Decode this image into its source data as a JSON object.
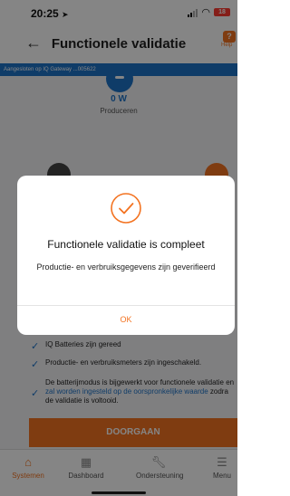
{
  "status_bar": {
    "time": "20:25",
    "location_glyph": "➤",
    "battery_level": "18"
  },
  "header": {
    "title": "Functionele validatie",
    "back_icon": "back-arrow-icon",
    "help_label": "Help"
  },
  "connection": {
    "text": "Aangesloten op IQ Gateway ...005622"
  },
  "produce": {
    "value": "0 W",
    "label": "Produceren"
  },
  "checklist": [
    {
      "text": "IQ Batteries zijn gereed"
    },
    {
      "text": "Productie- en verbruiksmeters zijn ingeschakeld."
    },
    {
      "text_before": "De batterijmodus is bijgewerkt voor functionele validatie en ",
      "link": "zal worden ingesteld op de oorspronkelijke waarde",
      "text_after": " zodra de validatie is voltooid."
    }
  ],
  "next_button": "DOORGAAN",
  "bottom_nav": [
    {
      "label": "Systemen",
      "icon": "home-icon",
      "active": true
    },
    {
      "label": "Dashboard",
      "icon": "dashboard-icon",
      "active": false
    },
    {
      "label": "Ondersteuning",
      "icon": "wrench-icon",
      "active": false
    },
    {
      "label": "Menu",
      "icon": "menu-icon",
      "active": false
    }
  ],
  "modal": {
    "title": "Functionele validatie is compleet",
    "message": "Productie- en verbruiksgegevens zijn geverifieerd",
    "ok_label": "OK",
    "icon": "check-circle-icon"
  },
  "colors": {
    "accent": "#f37321",
    "blue": "#1e73c8",
    "overlay": "rgba(0,0,0,0.48)"
  }
}
